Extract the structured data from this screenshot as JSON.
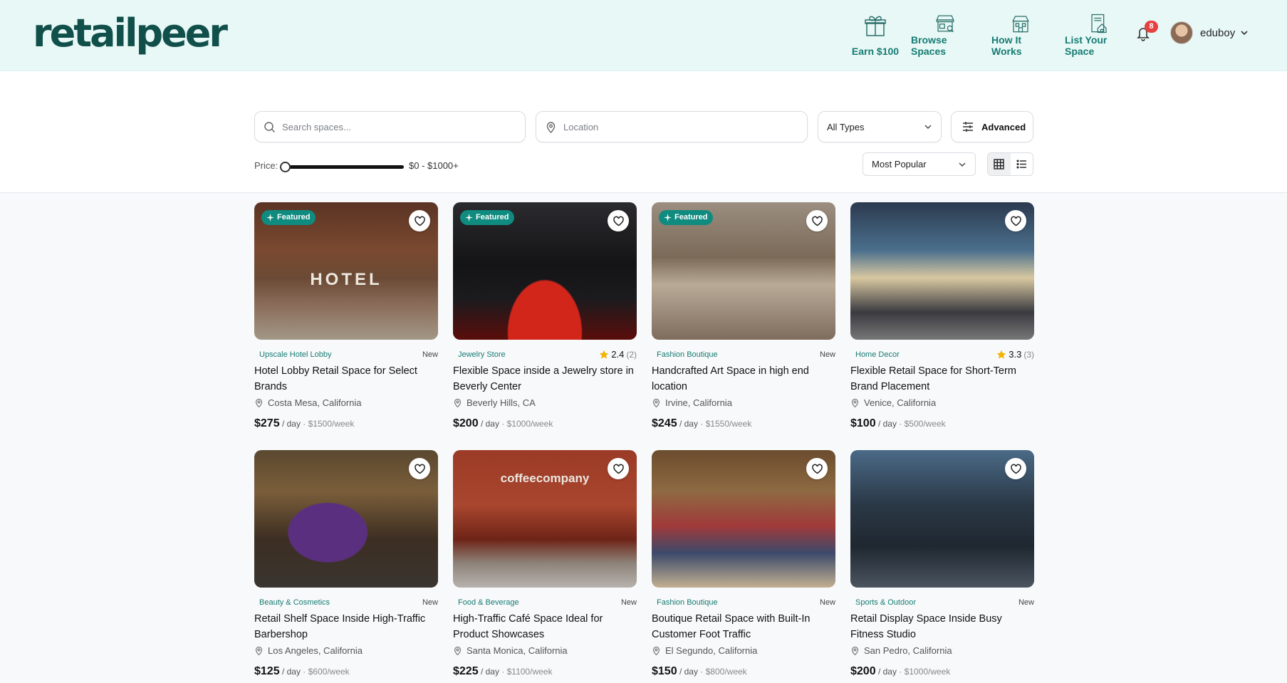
{
  "header": {
    "logo": "retailpeer",
    "nav": [
      {
        "label": "Earn $100",
        "icon": "gift-icon"
      },
      {
        "label": "Browse Spaces",
        "icon": "storefront-icon"
      },
      {
        "label": "How It Works",
        "icon": "building-icon"
      },
      {
        "label": "List Your Space",
        "icon": "document-house-icon"
      }
    ],
    "notifications": {
      "icon": "bell-icon",
      "count": "8"
    },
    "user": {
      "name": "eduboy",
      "icon": "chevron-down-icon"
    }
  },
  "filters": {
    "search_placeholder": "Search spaces...",
    "location_placeholder": "Location",
    "type_select": "All Types",
    "advanced_label": "Advanced",
    "price_label": "Price:",
    "price_range": "$0 - $1000+",
    "sort_select": "Most Popular",
    "view_modes": [
      "grid",
      "list"
    ]
  },
  "listings": [
    {
      "featured": "Featured",
      "category": "Upscale Hotel Lobby",
      "status": "New",
      "rating": null,
      "title": "Hotel Lobby Retail Space for Select Brands",
      "location": "Costa Mesa, California",
      "price": "$275",
      "per_day": "/ day",
      "weekly": "· $1500/week",
      "image_text": "HOTEL"
    },
    {
      "featured": "Featured",
      "category": "Jewelry Store",
      "status": null,
      "rating": "2.4",
      "rating_count": "(2)",
      "title": "Flexible Space inside a Jewelry store in Beverly Center",
      "location": "Beverly Hills, CA",
      "price": "$200",
      "per_day": "/ day",
      "weekly": "· $1000/week"
    },
    {
      "featured": "Featured",
      "category": "Fashion Boutique",
      "status": "New",
      "rating": null,
      "title": "Handcrafted Art Space in high end location",
      "location": "Irvine, California",
      "price": "$245",
      "per_day": "/ day",
      "weekly": "· $1550/week"
    },
    {
      "featured": null,
      "category": "Home Decor",
      "status": null,
      "rating": "3.3",
      "rating_count": "(3)",
      "title": "Flexible Retail Space for Short-Term Brand Placement",
      "location": "Venice, California",
      "price": "$100",
      "per_day": "/ day",
      "weekly": "· $500/week"
    },
    {
      "featured": null,
      "category": "Beauty & Cosmetics",
      "status": "New",
      "rating": null,
      "title": "Retail Shelf Space Inside High-Traffic Barbershop",
      "location": "Los Angeles, California",
      "price": "$125",
      "per_day": "/ day",
      "weekly": "· $600/week"
    },
    {
      "featured": null,
      "category": "Food & Beverage",
      "status": "New",
      "rating": null,
      "title": "High-Traffic Café Space Ideal for Product Showcases",
      "location": "Santa Monica, California",
      "price": "$225",
      "per_day": "/ day",
      "weekly": "· $1100/week",
      "image_text": "coffeecompany"
    },
    {
      "featured": null,
      "category": "Fashion Boutique",
      "status": "New",
      "rating": null,
      "title": "Boutique Retail Space with Built-In Customer Foot Traffic",
      "location": "El Segundo, California",
      "price": "$150",
      "per_day": "/ day",
      "weekly": "· $800/week"
    },
    {
      "featured": null,
      "category": "Sports & Outdoor",
      "status": "New",
      "rating": null,
      "title": "Retail Display Space Inside Busy Fitness Studio",
      "location": "San Pedro, California",
      "price": "$200",
      "per_day": "/ day",
      "weekly": "· $1000/week"
    }
  ],
  "colors": {
    "brand": "#114f4a",
    "accent": "#167c73",
    "header_bg": "#e8f8f6",
    "badge": "#e74040",
    "featured": "#0f8b7f",
    "star": "#f5b301"
  }
}
